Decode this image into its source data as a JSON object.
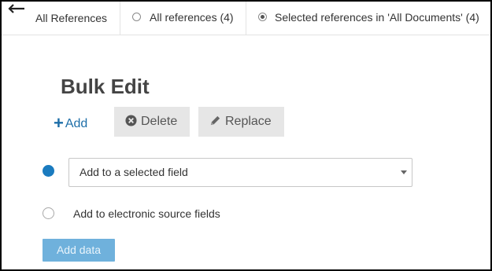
{
  "header": {
    "back_icon": "arrow-left-icon",
    "all_references_tab": "All References",
    "options": [
      {
        "label": "All references (4)",
        "selected": false
      },
      {
        "label": "Selected references in 'All Documents' (4)",
        "selected": true
      }
    ]
  },
  "main": {
    "title": "Bulk Edit",
    "actions": {
      "add_label": "Add",
      "add_icon": "plus-icon",
      "delete_label": "Delete",
      "delete_icon": "circle-x-icon",
      "replace_label": "Replace",
      "replace_icon": "pencil-icon"
    },
    "field_select": {
      "value": "Add to a selected field",
      "selected": true
    },
    "electronic_option": {
      "label": "Add to electronic source fields",
      "selected": false
    },
    "submit_label": "Add data"
  },
  "colors": {
    "accent": "#1a7bbf",
    "link": "#1d6ea8",
    "button_gray": "#e6e6e6",
    "submit_disabled": "#6fb1dc"
  }
}
